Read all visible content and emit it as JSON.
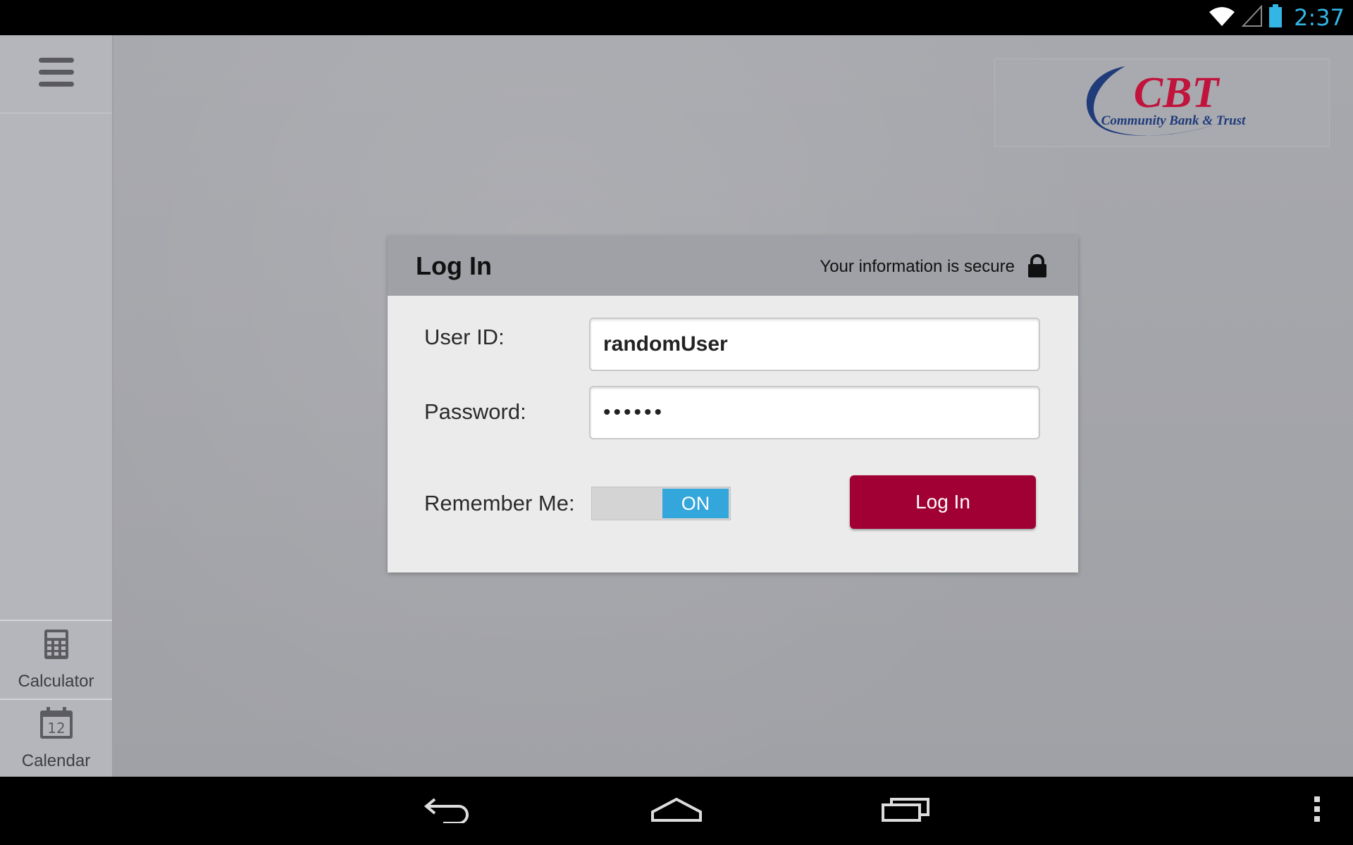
{
  "status_bar": {
    "time": "2:37",
    "icons": [
      "wifi-icon",
      "cell-signal-icon",
      "battery-icon"
    ],
    "accent_color": "#33b5e5"
  },
  "sidebar": {
    "menu_icon": "hamburger-menu-icon",
    "tools": [
      {
        "label": "Calculator",
        "icon": "calculator-icon"
      },
      {
        "label": "Calendar",
        "icon": "calendar-icon",
        "icon_text": "12"
      }
    ]
  },
  "logo": {
    "brand": "CBT",
    "tagline": "Community Bank & Trust",
    "brand_color": "#c0143c",
    "tagline_color": "#1f3b7a"
  },
  "login": {
    "title": "Log In",
    "secure_text": "Your information is secure",
    "user_id_label": "User ID:",
    "user_id_value": "randomUser",
    "password_label": "Password:",
    "password_value": "••••••",
    "remember_label": "Remember Me:",
    "remember_state": "ON",
    "button_label": "Log In",
    "button_color": "#a00033",
    "toggle_color": "#33a6dc"
  },
  "nav_bar": {
    "items": [
      "back-icon",
      "home-icon",
      "recent-apps-icon",
      "overflow-menu-icon"
    ]
  }
}
